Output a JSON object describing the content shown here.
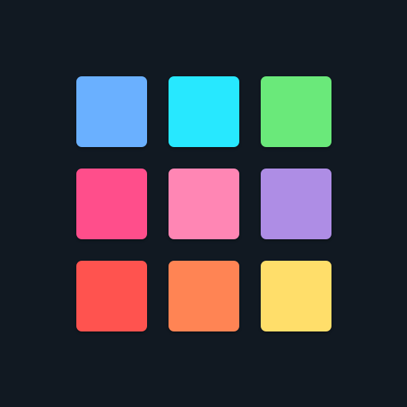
{
  "background": "#111922",
  "tiles": [
    {
      "color": "#6AB0FF"
    },
    {
      "color": "#27E8FF"
    },
    {
      "color": "#6AE97A"
    },
    {
      "color": "#FF4E8B"
    },
    {
      "color": "#FF86B4"
    },
    {
      "color": "#AE8DE5"
    },
    {
      "color": "#FF534F"
    },
    {
      "color": "#FF8454"
    },
    {
      "color": "#FFDE6A"
    }
  ]
}
